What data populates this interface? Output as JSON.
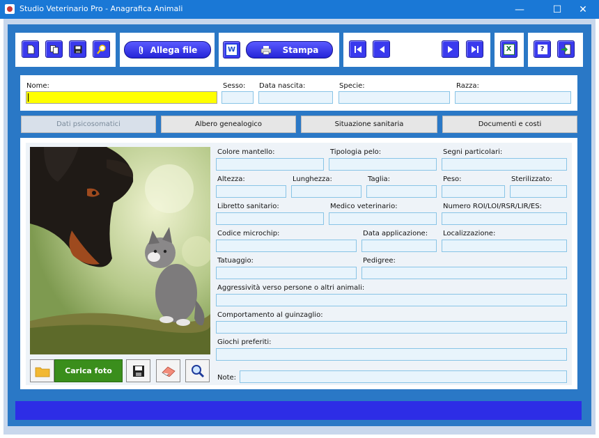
{
  "window": {
    "title": "Studio Veterinario Pro - Anagrafica Animali",
    "min_symbol": "—",
    "max_symbol": "☐",
    "close_symbol": "✕"
  },
  "toolbar": {
    "attach_label": "Allega file",
    "print_label": "Stampa",
    "word_glyph": "W",
    "excel_glyph": "X",
    "help_glyph": "?",
    "icons": [
      "new-document-icon",
      "copy-icon",
      "save-disk-icon",
      "search-magnifier-icon",
      "paperclip-icon",
      "word-icon",
      "printer-icon",
      "first-record-icon",
      "previous-record-icon",
      "next-record-icon",
      "last-record-icon",
      "excel-icon",
      "help-icon",
      "exit-icon"
    ]
  },
  "header_fields": {
    "nome": "Nome:",
    "sesso": "Sesso:",
    "data_nascita": "Data nascita:",
    "specie": "Specie:",
    "razza": "Razza:"
  },
  "tabs": [
    {
      "label": "Dati psicosomatici",
      "active": true
    },
    {
      "label": "Albero genealogico",
      "active": false
    },
    {
      "label": "Situazione sanitaria",
      "active": false
    },
    {
      "label": "Documenti e costi",
      "active": false
    }
  ],
  "fields": {
    "colore_mantello": "Colore mantello:",
    "tipologia_pelo": "Tipologia pelo:",
    "segni_particolari": "Segni particolari:",
    "altezza": "Altezza:",
    "lunghezza": "Lunghezza:",
    "taglia": "Taglia:",
    "peso": "Peso:",
    "sterilizzato": "Sterilizzato:",
    "libretto_sanitario": "Libretto sanitario:",
    "medico_veterinario": "Medico veterinario:",
    "numero_roi": "Numero ROI/LOI/RSR/LIR/ES:",
    "codice_microchip": "Codice microchip:",
    "data_applicazione": "Data applicazione:",
    "localizzazione": "Localizzazione:",
    "tatuaggio": "Tatuaggio:",
    "pedigree": "Pedigree:",
    "aggressivita": "Aggressività verso persone o altri animali:",
    "comportamento": "Comportamento al guinzaglio:",
    "giochi": "Giochi preferiti:",
    "note": "Note:"
  },
  "photo_buttons": {
    "load_label": "Carica foto",
    "icons": [
      "folder-icon",
      "save-disk-icon",
      "eraser-icon",
      "zoom-magnifier-icon"
    ]
  },
  "colors": {
    "titlebar": "#1a78d6",
    "toolbar_area": "#2a78c6",
    "button_blue": "#3a3aee",
    "name_field_highlight": "#ffff00",
    "field_fill": "#e8f4fc",
    "field_border": "#88c4e6",
    "load_photo_green": "#3a8e1c",
    "footer_bar": "#2d2de6"
  }
}
